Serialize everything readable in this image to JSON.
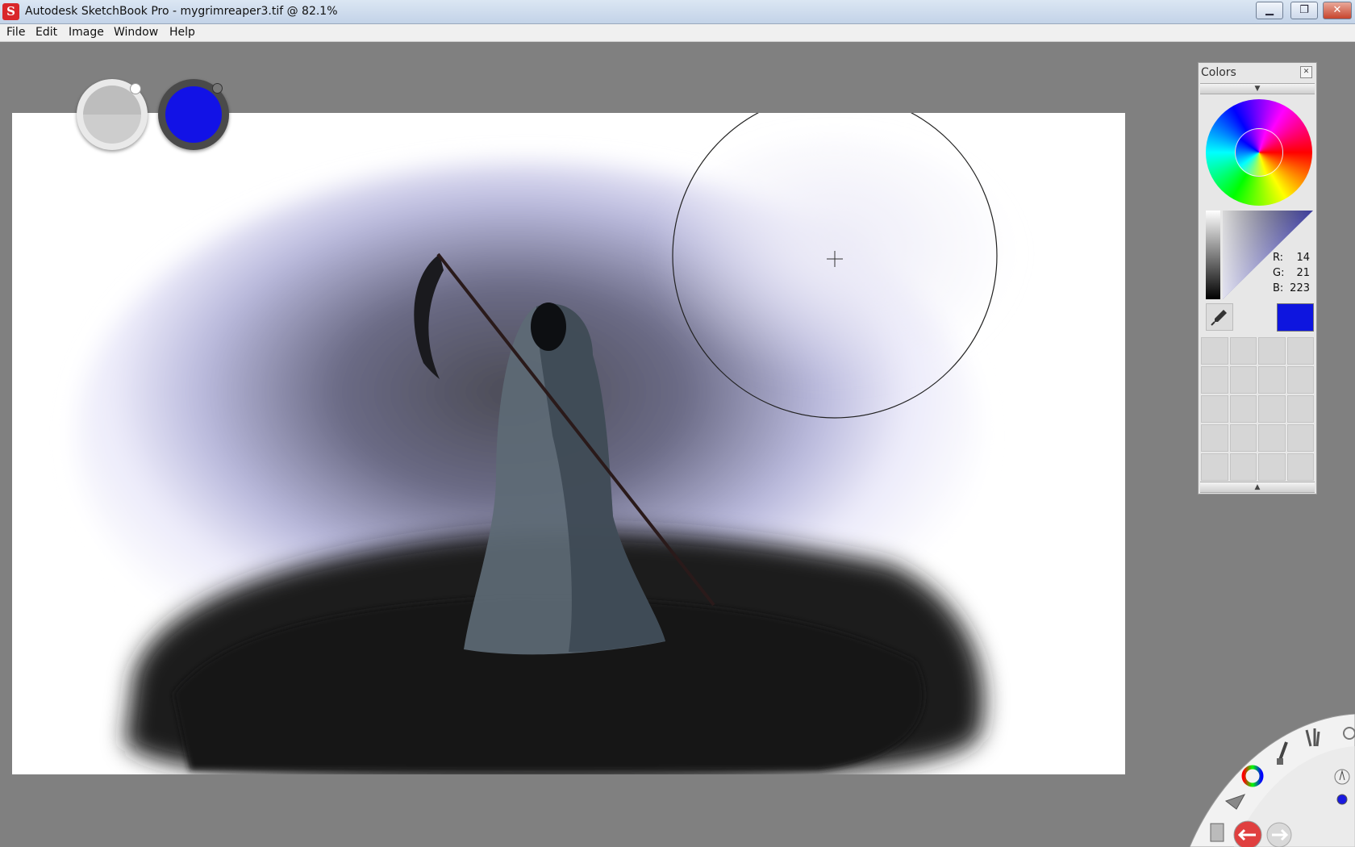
{
  "window": {
    "title": "Autodesk SketchBook Pro - mygrimreaper3.tif @ 82.1%",
    "app_icon": "S"
  },
  "controls": {
    "minimize": "▁",
    "restore": "❐",
    "close": "✕"
  },
  "menu": {
    "items": [
      "File",
      "Edit",
      "Image",
      "Window",
      "Help"
    ]
  },
  "pucks": {
    "brush_color": "#c4c4c4",
    "fill_color": "#1212e6"
  },
  "colors_panel": {
    "title": "Colors",
    "rgb": {
      "r_label": "R:",
      "r": "14",
      "g_label": "G:",
      "g": "21",
      "b_label": "B:",
      "b": "223"
    },
    "current_color": "#0e15df",
    "collapse_arrow": "▼",
    "expand_arrow": "▲"
  },
  "icons": [
    "color-wheel-icon",
    "brush-icon",
    "select-icon",
    "undo-icon",
    "redo-icon",
    "layer-icon"
  ]
}
